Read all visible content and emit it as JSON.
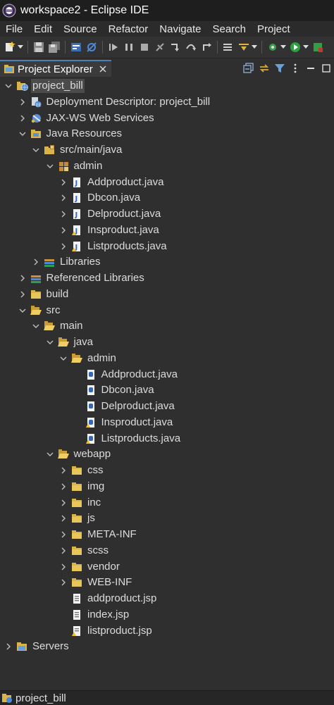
{
  "window": {
    "title": "workspace2 - Eclipse IDE"
  },
  "menu": [
    "File",
    "Edit",
    "Source",
    "Refactor",
    "Navigate",
    "Search",
    "Project"
  ],
  "toolbar_icons": [
    "new-icon",
    "save-icon",
    "save-all-icon",
    "console-icon",
    "skip-breakpoints-icon",
    "resume-icon",
    "suspend-icon",
    "terminate-icon",
    "disconnect-icon",
    "step-into-icon",
    "step-over-icon",
    "step-return-icon",
    "drop-to-frame-icon",
    "use-step-filters-icon",
    "external-tools-icon",
    "run-icon",
    "debug-icon"
  ],
  "view": {
    "tab_label": "Project Explorer"
  },
  "tree": [
    {
      "label": "project_bill",
      "depth": 0,
      "state": "open",
      "icon": "web-project-icon",
      "selected": true
    },
    {
      "label": "Deployment Descriptor: project_bill",
      "depth": 1,
      "state": "closed",
      "icon": "deployment-descriptor-icon"
    },
    {
      "label": "JAX-WS Web Services",
      "depth": 1,
      "state": "closed",
      "icon": "web-services-icon"
    },
    {
      "label": "Java Resources",
      "depth": 1,
      "state": "open",
      "icon": "java-resources-icon"
    },
    {
      "label": "src/main/java",
      "depth": 2,
      "state": "open",
      "icon": "source-folder-icon"
    },
    {
      "label": "admin",
      "depth": 3,
      "state": "open",
      "icon": "package-icon"
    },
    {
      "label": "Addproduct.java",
      "depth": 4,
      "state": "closed",
      "icon": "java-file-icon"
    },
    {
      "label": "Dbcon.java",
      "depth": 4,
      "state": "closed",
      "icon": "java-file-icon"
    },
    {
      "label": "Delproduct.java",
      "depth": 4,
      "state": "closed",
      "icon": "java-file-icon"
    },
    {
      "label": "Insproduct.java",
      "depth": 4,
      "state": "closed",
      "icon": "java-file-warning-icon"
    },
    {
      "label": "Listproducts.java",
      "depth": 4,
      "state": "closed",
      "icon": "java-file-warning-icon"
    },
    {
      "label": "Libraries",
      "depth": 2,
      "state": "closed",
      "icon": "libraries-icon"
    },
    {
      "label": "Referenced Libraries",
      "depth": 1,
      "state": "closed",
      "icon": "libraries-icon"
    },
    {
      "label": "build",
      "depth": 1,
      "state": "closed",
      "icon": "folder-icon"
    },
    {
      "label": "src",
      "depth": 1,
      "state": "open",
      "icon": "folder-open-icon"
    },
    {
      "label": "main",
      "depth": 2,
      "state": "open",
      "icon": "folder-open-icon"
    },
    {
      "label": "java",
      "depth": 3,
      "state": "open",
      "icon": "folder-open-icon"
    },
    {
      "label": "admin",
      "depth": 4,
      "state": "open",
      "icon": "folder-open-icon"
    },
    {
      "label": "Addproduct.java",
      "depth": 5,
      "state": "leaf",
      "icon": "java-text-file-icon"
    },
    {
      "label": "Dbcon.java",
      "depth": 5,
      "state": "leaf",
      "icon": "java-text-file-icon"
    },
    {
      "label": "Delproduct.java",
      "depth": 5,
      "state": "leaf",
      "icon": "java-text-file-icon"
    },
    {
      "label": "Insproduct.java",
      "depth": 5,
      "state": "leaf",
      "icon": "java-text-file-warning-icon"
    },
    {
      "label": "Listproducts.java",
      "depth": 5,
      "state": "leaf",
      "icon": "java-text-file-warning-icon"
    },
    {
      "label": "webapp",
      "depth": 3,
      "state": "open",
      "icon": "folder-open-icon"
    },
    {
      "label": "css",
      "depth": 4,
      "state": "closed",
      "icon": "folder-icon"
    },
    {
      "label": "img",
      "depth": 4,
      "state": "closed",
      "icon": "folder-icon"
    },
    {
      "label": "inc",
      "depth": 4,
      "state": "closed",
      "icon": "folder-icon"
    },
    {
      "label": "js",
      "depth": 4,
      "state": "closed",
      "icon": "folder-icon"
    },
    {
      "label": "META-INF",
      "depth": 4,
      "state": "closed",
      "icon": "folder-icon"
    },
    {
      "label": "scss",
      "depth": 4,
      "state": "closed",
      "icon": "folder-icon"
    },
    {
      "label": "vendor",
      "depth": 4,
      "state": "closed",
      "icon": "folder-icon"
    },
    {
      "label": "WEB-INF",
      "depth": 4,
      "state": "closed",
      "icon": "folder-icon"
    },
    {
      "label": "addproduct.jsp",
      "depth": 4,
      "state": "leaf",
      "icon": "jsp-file-icon"
    },
    {
      "label": "index.jsp",
      "depth": 4,
      "state": "leaf",
      "icon": "jsp-file-icon"
    },
    {
      "label": "listproduct.jsp",
      "depth": 4,
      "state": "leaf",
      "icon": "jsp-file-warning-icon"
    },
    {
      "label": "Servers",
      "depth": 0,
      "state": "closed",
      "icon": "servers-folder-icon"
    }
  ],
  "status": {
    "label": "project_bill"
  }
}
